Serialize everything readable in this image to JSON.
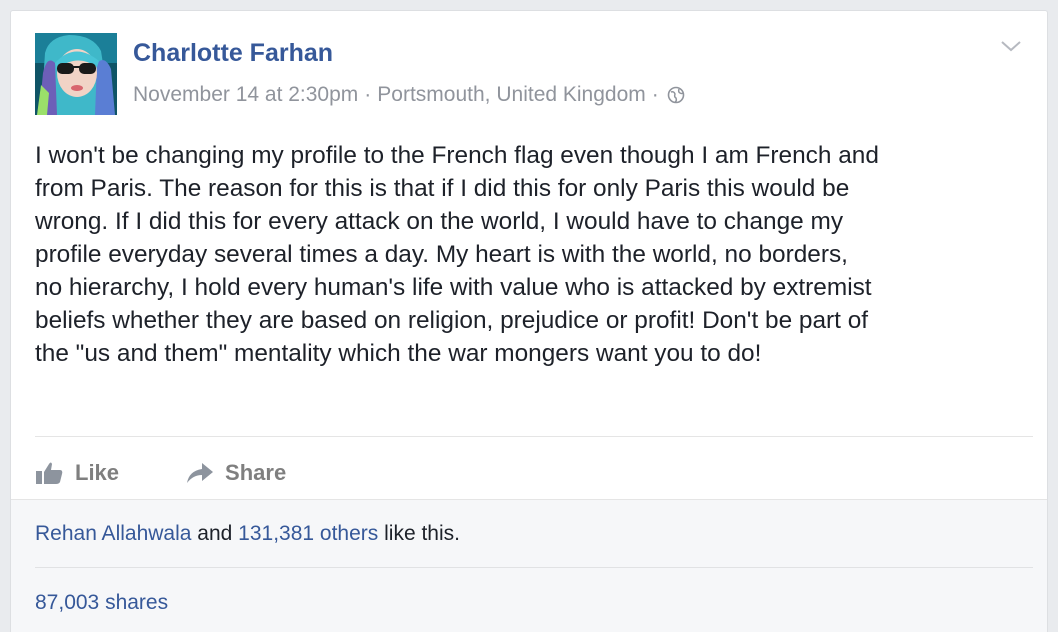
{
  "post": {
    "author": "Charlotte Farhan",
    "date": "November 14 at 2:30pm",
    "separator": "·",
    "location": "Portsmouth, United Kingdom",
    "privacy_icon": "globe-icon",
    "menu_icon": "chevron-down-icon",
    "text": "I won't be changing my profile to the French flag even though I am French and\nfrom Paris. The reason for this is that if I did this for only Paris this would be\nwrong. If I did this for every attack on the world, I would have to change my\nprofile everyday several times a day. My heart is with the world, no borders,\nno hierarchy, I hold every human's life with value who is attacked by extremist\nbeliefs whether they are based on religion, prejudice or profit! Don't be part of\nthe \"us and them\" mentality which the war mongers want you to do!"
  },
  "actions": {
    "like_label": "Like",
    "like_icon": "thumbs-up-icon",
    "share_label": "Share",
    "share_icon": "share-arrow-icon"
  },
  "footer": {
    "liker_name": "Rehan Allahwala",
    "and_text": " and ",
    "others_count": "131,381 others",
    "like_suffix": " like this.",
    "shares": "87,003 shares"
  },
  "colors": {
    "link": "#365899",
    "meta": "#90949c",
    "text": "#1d2129",
    "action": "#7f7f7f",
    "footer_bg": "#f6f7f9"
  }
}
